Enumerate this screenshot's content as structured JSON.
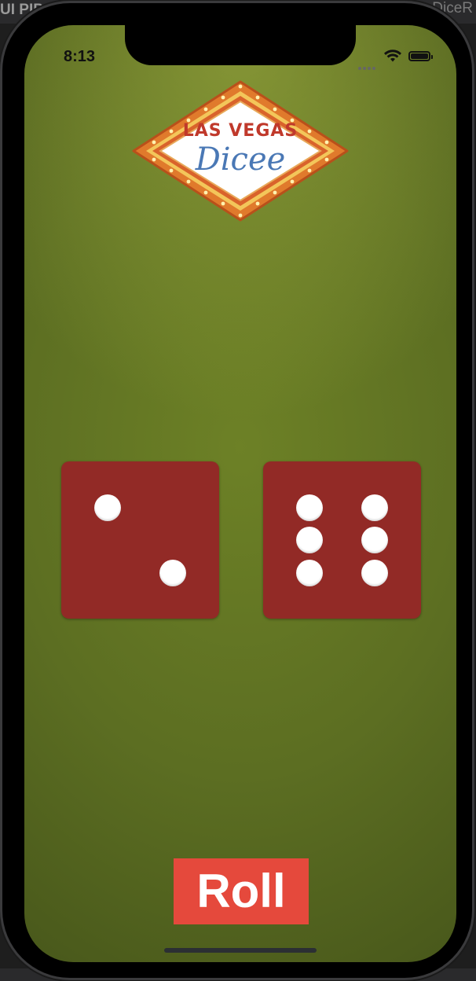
{
  "host": {
    "left_text": "UI PIP",
    "right_text": "DiceR"
  },
  "status_bar": {
    "time": "8:13",
    "wifi_icon": "wifi-icon",
    "battery_icon": "battery-icon",
    "signal_icon": "cellular-dots-icon"
  },
  "logo": {
    "line1": "LAS VEGAS",
    "line2": "Dicee"
  },
  "dice": [
    {
      "name": "left-die",
      "value": 2
    },
    {
      "name": "right-die",
      "value": 6
    }
  ],
  "roll_button": {
    "label": "Roll"
  },
  "colors": {
    "felt": "#5c6e22",
    "die": "#922a26",
    "pip": "#ffffff",
    "roll_button": "#e5493c",
    "logo_red": "#c0392b",
    "logo_blue": "#4a78b5"
  }
}
